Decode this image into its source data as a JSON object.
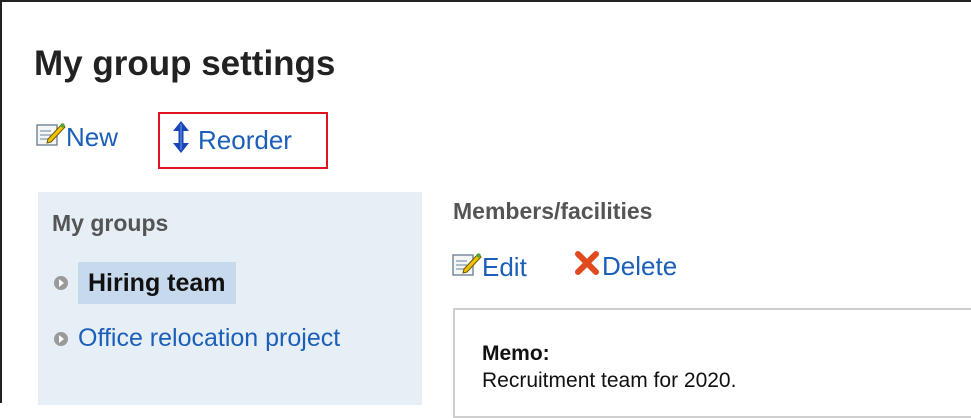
{
  "page": {
    "title": "My group settings"
  },
  "toolbar": {
    "new_label": "New",
    "reorder_label": "Reorder"
  },
  "sidebar": {
    "title": "My groups",
    "groups": [
      {
        "label": "Hiring team",
        "selected": true
      },
      {
        "label": "Office relocation project",
        "selected": false
      }
    ]
  },
  "main": {
    "section_title": "Members/facilities",
    "edit_label": "Edit",
    "delete_label": "Delete",
    "memo": {
      "label": "Memo:",
      "text": "Recruitment team for 2020."
    }
  },
  "icons": {
    "new": "edit-pencil-icon",
    "reorder": "vertical-arrows-icon",
    "edit": "edit-pencil-icon",
    "delete": "red-x-icon",
    "group_bullet": "circle-arrow-bullet-icon"
  },
  "colors": {
    "link": "#1c5fb8",
    "highlight_box": "#e0141e",
    "sidebar_bg": "#e6eef6",
    "selected_bg": "#c7d9ec",
    "delete_icon": "#e04a1e"
  }
}
